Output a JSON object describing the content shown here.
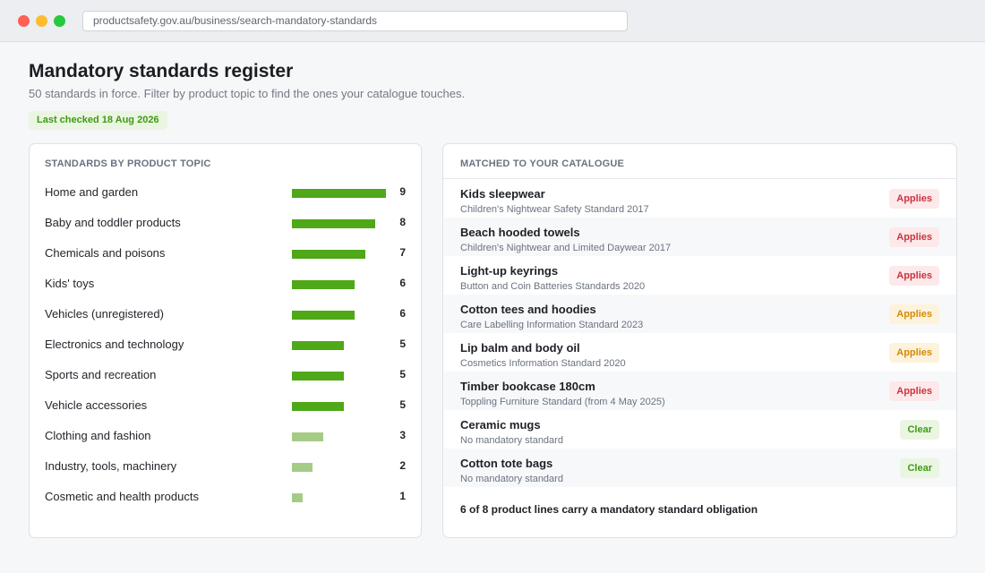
{
  "browser": {
    "url": "productsafety.gov.au/business/search-mandatory-standards"
  },
  "header": {
    "title": "Mandatory standards register",
    "subtitle": "50 standards in force. Filter by product topic to find the ones your catalogue touches.",
    "last_checked": "Last checked 18 Aug 2026"
  },
  "topics_panel": {
    "heading": "STANDARDS BY PRODUCT TOPIC",
    "scale_max": 9,
    "items": [
      {
        "label": "Home and garden",
        "count": 9,
        "color": "#4fa818"
      },
      {
        "label": "Baby and toddler products",
        "count": 8,
        "color": "#4fa818"
      },
      {
        "label": "Chemicals and poisons",
        "count": 7,
        "color": "#4fa818"
      },
      {
        "label": "Kids' toys",
        "count": 6,
        "color": "#4fa818"
      },
      {
        "label": "Vehicles (unregistered)",
        "count": 6,
        "color": "#4fa818"
      },
      {
        "label": "Electronics and technology",
        "count": 5,
        "color": "#4fa818"
      },
      {
        "label": "Sports and recreation",
        "count": 5,
        "color": "#4fa818"
      },
      {
        "label": "Vehicle accessories",
        "count": 5,
        "color": "#4fa818"
      },
      {
        "label": "Clothing and fashion",
        "count": 3,
        "color": "#a5cc86"
      },
      {
        "label": "Industry, tools, machinery",
        "count": 2,
        "color": "#a5cc86"
      },
      {
        "label": "Cosmetic and health products",
        "count": 1,
        "color": "#a5cc86"
      }
    ]
  },
  "catalogue_panel": {
    "heading": "MATCHED TO YOUR CATALOGUE",
    "items": [
      {
        "product": "Kids sleepwear",
        "standard": "Children's Nightwear Safety Standard 2017",
        "status": "Applies",
        "tone": "red"
      },
      {
        "product": "Beach hooded towels",
        "standard": "Children's Nightwear and Limited Daywear 2017",
        "status": "Applies",
        "tone": "red"
      },
      {
        "product": "Light-up keyrings",
        "standard": "Button and Coin Batteries Standards 2020",
        "status": "Applies",
        "tone": "red"
      },
      {
        "product": "Cotton tees and hoodies",
        "standard": "Care Labelling Information Standard 2023",
        "status": "Applies",
        "tone": "amber"
      },
      {
        "product": "Lip balm and body oil",
        "standard": "Cosmetics Information Standard 2020",
        "status": "Applies",
        "tone": "amber"
      },
      {
        "product": "Timber bookcase 180cm",
        "standard": "Toppling Furniture Standard (from 4 May 2025)",
        "status": "Applies",
        "tone": "red"
      },
      {
        "product": "Ceramic mugs",
        "standard": "No mandatory standard",
        "status": "Clear",
        "tone": "green"
      },
      {
        "product": "Cotton tote bags",
        "standard": "No mandatory standard",
        "status": "Clear",
        "tone": "green"
      }
    ],
    "summary": "6 of 8 product lines carry a mandatory standard obligation"
  }
}
